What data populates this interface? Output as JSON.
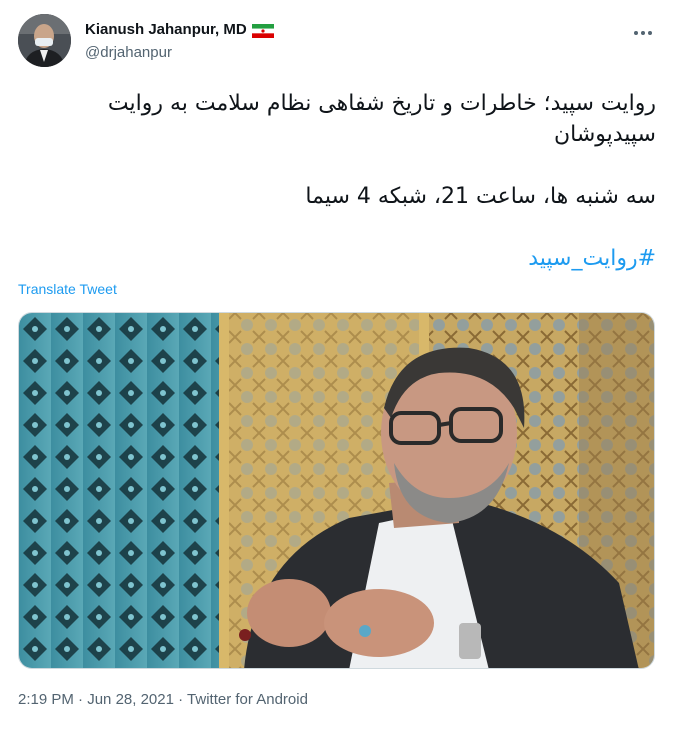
{
  "author": {
    "display_name": "Kianush Jahanpur, MD",
    "handle": "@drjahanpur",
    "flag_icon": "iran-flag-icon"
  },
  "tweet": {
    "line1": "روایت سپید؛ خاطرات و تاریخ شفاهی نظام سلامت به روایت سپیدپوشان",
    "line2": "سه شنبه ها، ساعت 21، شبکه 4 سیما",
    "hashtag": "#روایت_سپید"
  },
  "translate_label": "Translate Tweet",
  "meta": {
    "time": "2:19 PM",
    "date": "Jun 28, 2021",
    "source": "Twitter for Android",
    "separator": "·"
  },
  "colors": {
    "link": "#1d9bf0",
    "secondary_text": "#536471",
    "primary_text": "#0f1419"
  }
}
